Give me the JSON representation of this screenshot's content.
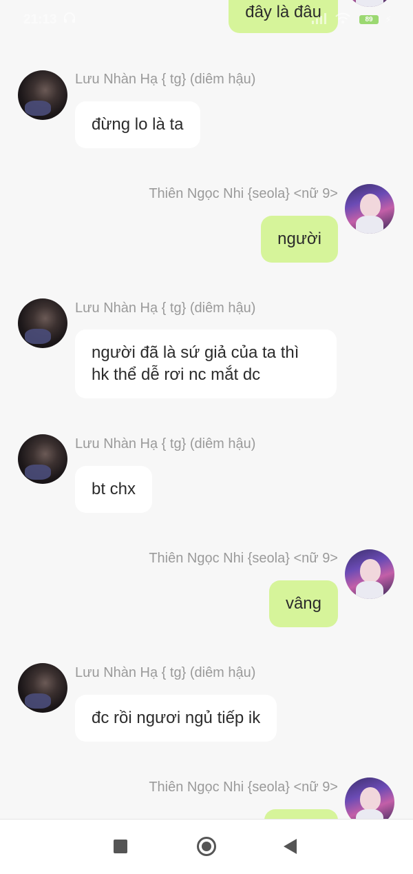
{
  "status_bar": {
    "time": "21:13",
    "battery": "89"
  },
  "messages": [
    {
      "side": "out",
      "sender": "",
      "text": "đây là đâu"
    },
    {
      "side": "in",
      "sender": "Lưu Nhàn Hạ { tg} (diêm hậu)",
      "text": "đừng lo là ta"
    },
    {
      "side": "out",
      "sender": "Thiên Ngọc Nhi {seola} <nữ 9>",
      "text": "người"
    },
    {
      "side": "in",
      "sender": "Lưu Nhàn Hạ { tg} (diêm hậu)",
      "text": "người đã là sứ giả của ta thì hk thể dễ rơi nc mắt dc"
    },
    {
      "side": "in",
      "sender": "Lưu Nhàn Hạ { tg} (diêm hậu)",
      "text": "bt chx"
    },
    {
      "side": "out",
      "sender": "Thiên Ngọc Nhi {seola} <nữ 9>",
      "text": "vâng"
    },
    {
      "side": "in",
      "sender": "Lưu Nhàn Hạ { tg} (diêm hậu)",
      "text": "đc rồi ngươi ngủ tiếp ik"
    },
    {
      "side": "out",
      "sender": "Thiên Ngọc Nhi {seola} <nữ 9>",
      "text": ""
    }
  ],
  "nav_bar": {
    "recent_icon": "square-icon",
    "home_icon": "circle-home-icon",
    "back_icon": "triangle-back-icon"
  },
  "colors": {
    "outgoing_bubble": "#d6f49a",
    "incoming_bubble": "#ffffff",
    "background": "#f7f7f7",
    "name_text": "#9a9a9a"
  }
}
